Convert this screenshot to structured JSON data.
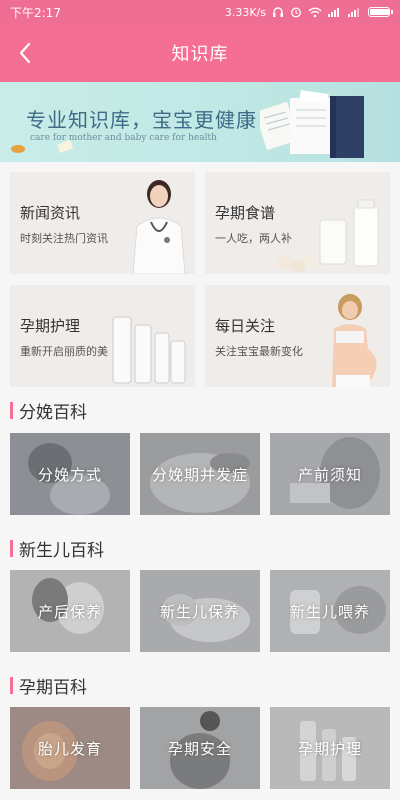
{
  "status_bar": {
    "time": "下午2:17",
    "speed": "3.33K/s",
    "battery_fraction": 0.95
  },
  "header": {
    "title": "知识库",
    "back_icon": "chevron-left-icon"
  },
  "banner": {
    "title": "专业知识库，宝宝更健康",
    "subtitle": "care for mother and baby    care for health"
  },
  "cards": [
    {
      "title": "新闻资讯",
      "subtitle": "时刻关注热门资讯"
    },
    {
      "title": "孕期食谱",
      "subtitle": "一人吃，两人补"
    },
    {
      "title": "孕期护理",
      "subtitle": "重新开启丽质的美"
    },
    {
      "title": "每日关注",
      "subtitle": "关注宝宝最新变化"
    }
  ],
  "sections": [
    {
      "title": "分娩百科",
      "items": [
        "分娩方式",
        "分娩期并发症",
        "产前须知"
      ]
    },
    {
      "title": "新生儿百科",
      "items": [
        "产后保养",
        "新生儿保养",
        "新生儿喂养"
      ]
    },
    {
      "title": "孕期百科",
      "items": [
        "胎儿发育",
        "孕期安全",
        "孕期护理"
      ]
    }
  ],
  "colors": {
    "accent": "#f46f93",
    "status_bar": "#ee6f93"
  }
}
